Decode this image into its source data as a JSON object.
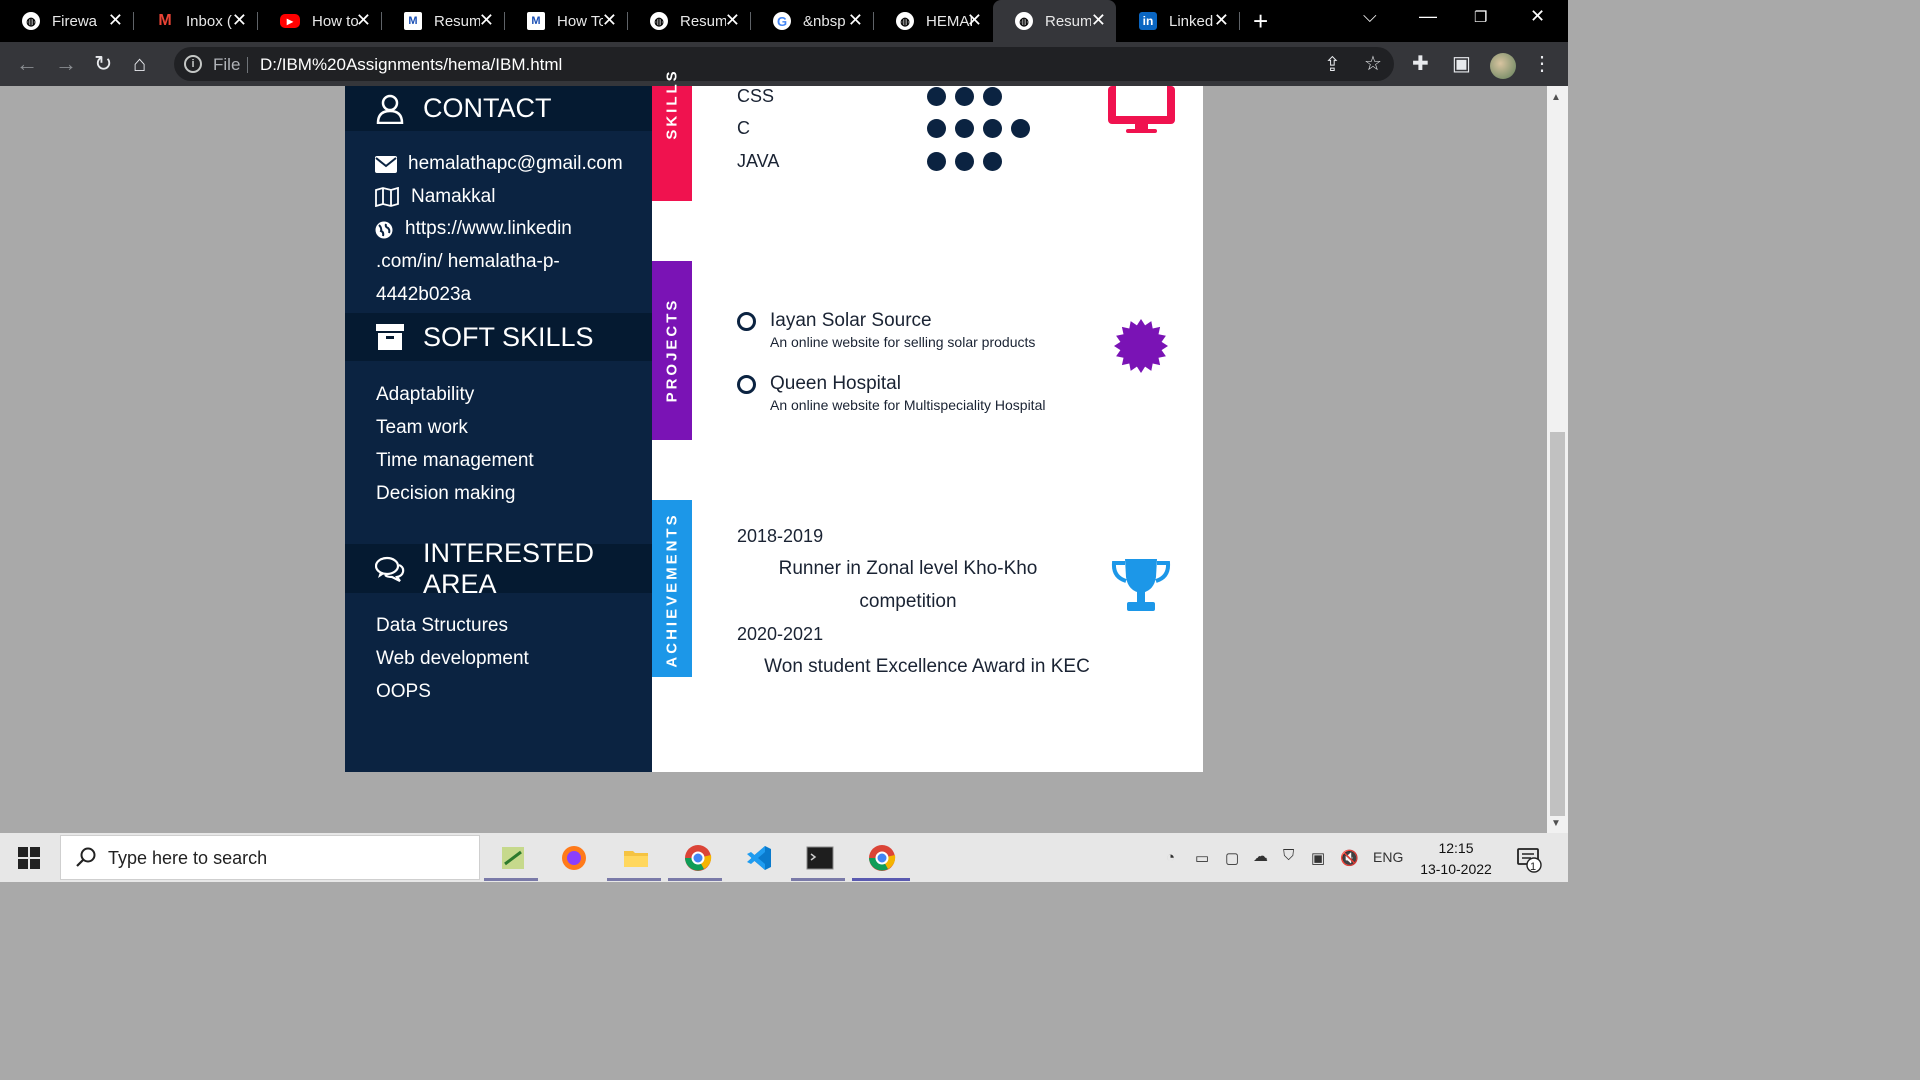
{
  "browser": {
    "tabs": [
      {
        "title": "Firewal",
        "icon": "globe-icon",
        "active": false
      },
      {
        "title": "Inbox (",
        "icon": "gmail-icon",
        "active": false
      },
      {
        "title": "How to",
        "icon": "youtube-icon",
        "active": false
      },
      {
        "title": "Resum",
        "icon": "medium-icon",
        "active": false
      },
      {
        "title": "How To",
        "icon": "medium-icon",
        "active": false
      },
      {
        "title": "Resum",
        "icon": "globe-icon",
        "active": false
      },
      {
        "title": "&nbsp",
        "icon": "google-icon",
        "active": false
      },
      {
        "title": "HEMAL",
        "icon": "globe-icon",
        "active": false
      },
      {
        "title": "Resum",
        "icon": "globe-icon",
        "active": true
      },
      {
        "title": "Linked",
        "icon": "linkedin-icon",
        "active": false
      }
    ],
    "address_scheme": "File",
    "url": "D:/IBM%20Assignments/hema/IBM.html"
  },
  "resume": {
    "contact": {
      "heading": "CONTACT",
      "email": "hemalathapc@gmail.com",
      "location": "Namakkal",
      "link_line1": "https://www.linkedin",
      "link_line2": ".com/in/ hemalatha-p-",
      "link_line3": "4442b023a"
    },
    "soft_skills": {
      "heading": "SOFT SKILLS",
      "items": [
        "Adaptability",
        "Team work",
        "Time management",
        "Decision making"
      ]
    },
    "interested_area": {
      "heading": "INTERESTED AREA",
      "items": [
        "Data Structures",
        "Web development",
        "OOPS"
      ]
    },
    "section_labels": {
      "skills": "SKILLS",
      "projects": "PROJECTS",
      "achievements": "ACHIEVEMENTS"
    },
    "skills": [
      {
        "name": "CSS",
        "level": 3
      },
      {
        "name": "C",
        "level": 4
      },
      {
        "name": "JAVA",
        "level": 3
      }
    ],
    "projects": [
      {
        "title": "Iayan Solar Source",
        "description": "An online website for selling solar products"
      },
      {
        "title": "Queen Hospital",
        "description": "An online website for Multispeciality Hospital"
      }
    ],
    "achievements": [
      {
        "year": "2018-2019",
        "line1": "Runner in Zonal level Kho-Kho",
        "line2": "competition"
      },
      {
        "year": "2020-2021",
        "line1": "Won student Excellence Award in KEC"
      }
    ],
    "colors": {
      "left_panel": "#0b2341",
      "left_heading": "#051a31",
      "skills_accent": "#f0124f",
      "projects_accent": "#7a13b5",
      "achievements_accent": "#1c97e8"
    }
  },
  "taskbar": {
    "search_placeholder": "Type here to search",
    "language": "ENG",
    "time": "12:15",
    "date": "13-10-2022",
    "notification_count": "1"
  }
}
